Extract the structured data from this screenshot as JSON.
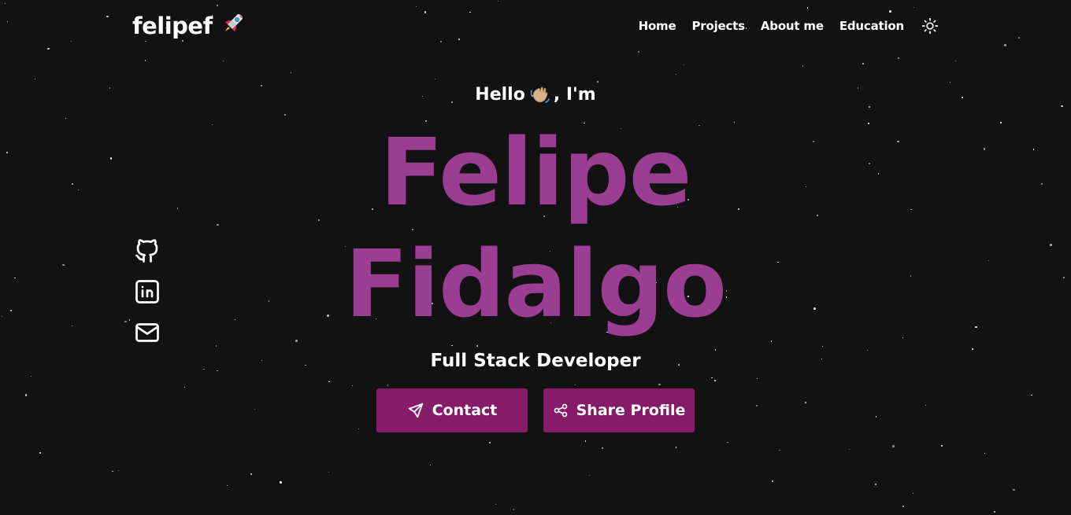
{
  "brand": {
    "name": "felipef",
    "icon": "rocket-icon"
  },
  "nav": {
    "items": [
      {
        "label": "Home"
      },
      {
        "label": "Projects"
      },
      {
        "label": "About me"
      },
      {
        "label": "Education"
      }
    ],
    "theme_toggle_icon": "sun-icon"
  },
  "socials": [
    {
      "icon": "github-icon"
    },
    {
      "icon": "linkedin-icon"
    },
    {
      "icon": "mail-icon"
    }
  ],
  "hero": {
    "greeting_prefix": "Hello",
    "greeting_icon": "waving-hand-icon",
    "greeting_suffix": ", I'm",
    "first_name": "Felipe",
    "last_name": "Fidalgo",
    "role": "Full Stack Developer"
  },
  "actions": {
    "contact_label": "Contact",
    "contact_icon": "send-icon",
    "share_label": "Share Profile",
    "share_icon": "share-icon"
  },
  "colors": {
    "background": "#121212",
    "name_accent": "#9c3d94",
    "button_bg": "#861b6a",
    "text": "#ffffff"
  }
}
